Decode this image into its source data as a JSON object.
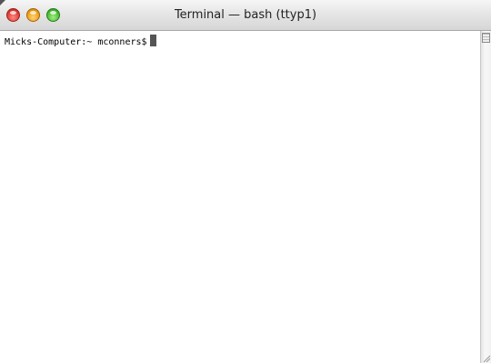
{
  "window": {
    "title": "Terminal — bash (ttyp1)"
  },
  "terminal": {
    "prompt": "Micks-Computer:~ mconners$"
  },
  "colors": {
    "close": "#e0443e",
    "minimize": "#f2a41a",
    "zoom": "#4fc23a",
    "background": "#ffffff",
    "text": "#000000"
  },
  "icons": {
    "close": "close-icon",
    "minimize": "minimize-icon",
    "zoom": "zoom-icon",
    "split": "split-pane-icon",
    "resize": "resize-grip-icon"
  }
}
